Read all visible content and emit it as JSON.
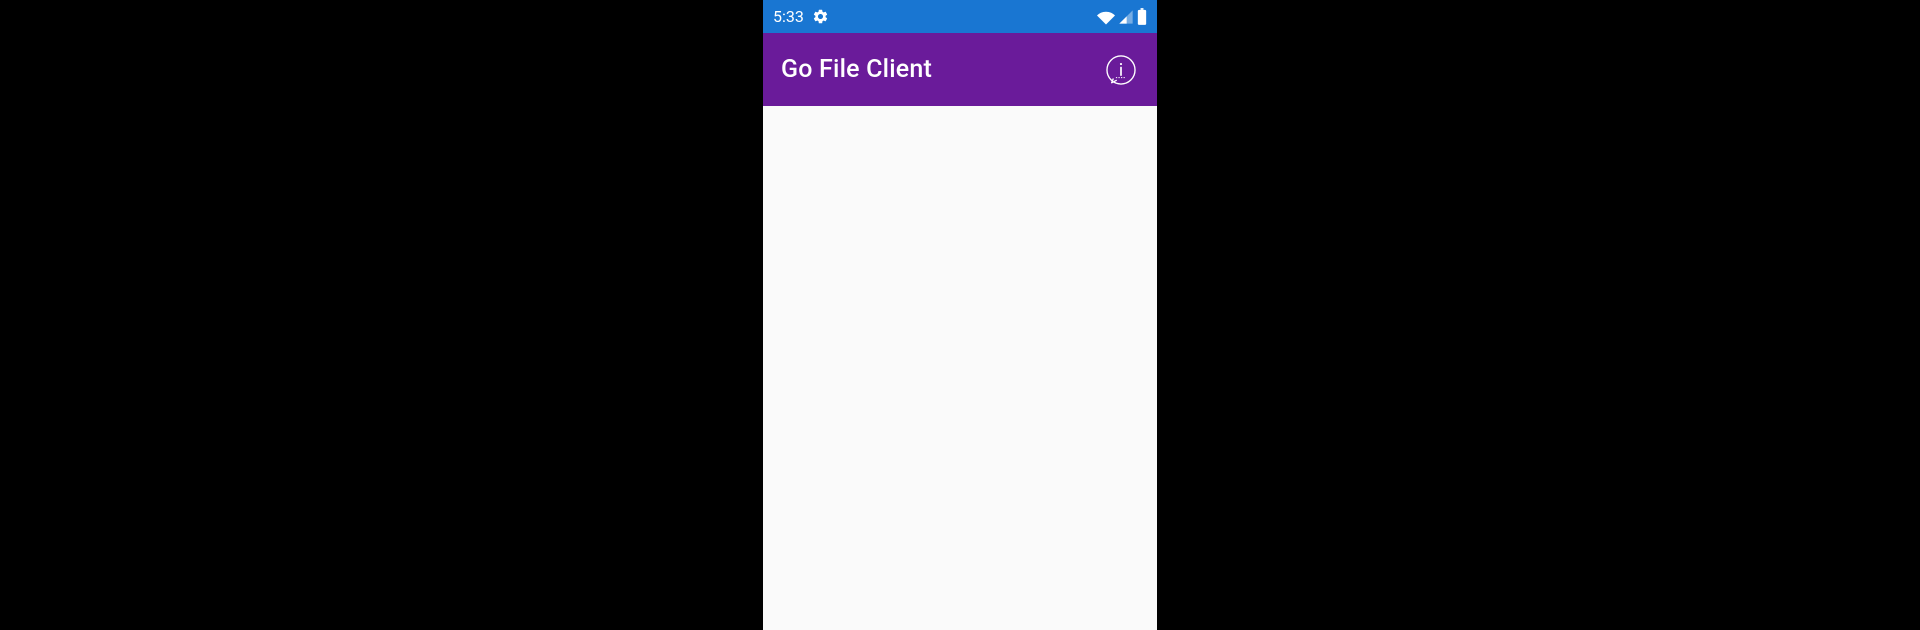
{
  "status_bar": {
    "time": "5:33",
    "colors": {
      "background": "#1976d2",
      "text": "#ffffff"
    }
  },
  "app_bar": {
    "title": "Go File Client",
    "colors": {
      "background": "#6a1b9a",
      "text": "#ffffff"
    }
  },
  "content": {
    "background": "#fafafa"
  }
}
